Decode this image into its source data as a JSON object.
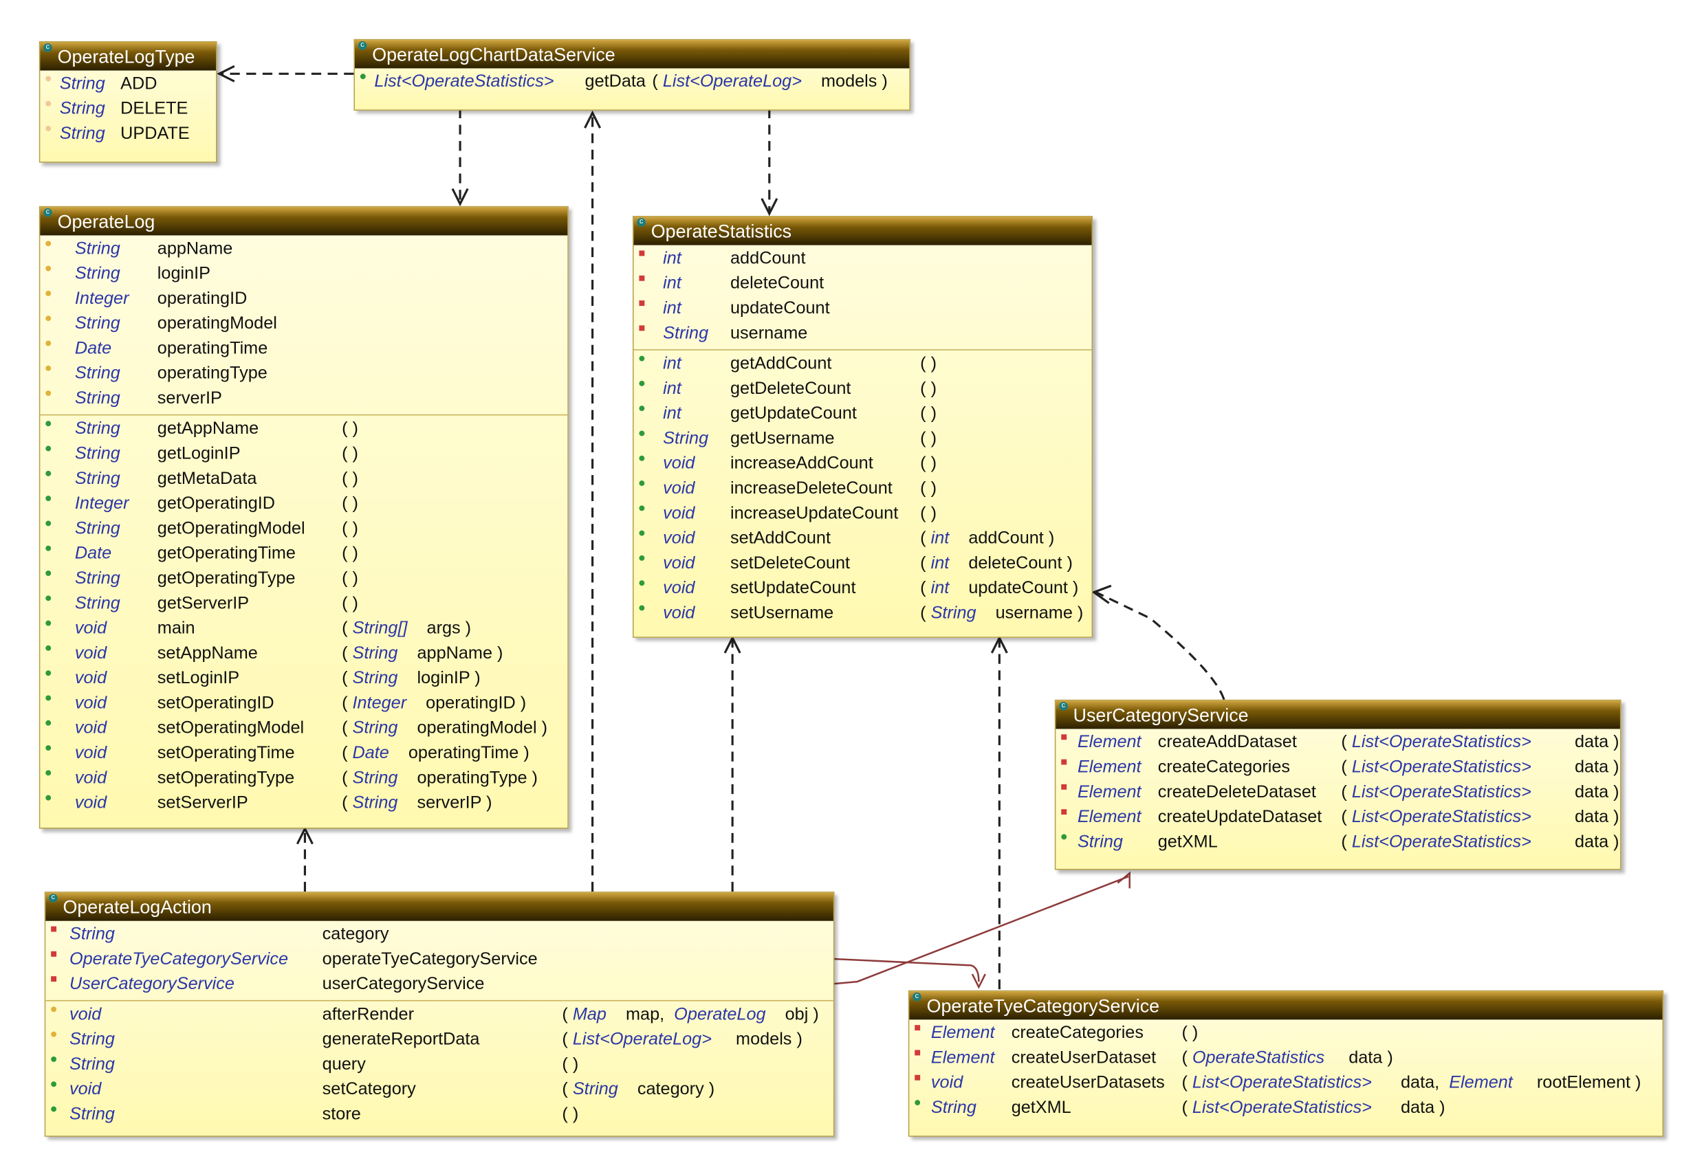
{
  "diagram": {
    "classes": [
      {
        "id": "operate-log-type",
        "title": "OperateLogType",
        "sections": [
          [
            {
              "vis": "pkg",
              "type": "String",
              "name": "ADD",
              "params": ""
            },
            {
              "vis": "pkg",
              "type": "String",
              "name": "DELETE",
              "params": ""
            },
            {
              "vis": "pkg",
              "type": "String",
              "name": "UPDATE",
              "params": ""
            }
          ]
        ]
      },
      {
        "id": "operate-log-chart-data-service",
        "title": "OperateLogChartDataService",
        "sections": [
          [
            {
              "vis": "pub",
              "type": "List<OperateStatistics>",
              "name": "getData",
              "params": "( <i>List&lt;OperateLog&gt;</i>&nbsp;&nbsp;&nbsp; models )"
            }
          ]
        ]
      },
      {
        "id": "operate-log",
        "title": "OperateLog",
        "sections": [
          [
            {
              "vis": "prot",
              "type": "String",
              "name": "appName",
              "params": ""
            },
            {
              "vis": "prot",
              "type": "String",
              "name": "loginIP",
              "params": ""
            },
            {
              "vis": "prot",
              "type": "Integer",
              "name": "operatingID",
              "params": ""
            },
            {
              "vis": "prot",
              "type": "String",
              "name": "operatingModel",
              "params": ""
            },
            {
              "vis": "prot",
              "type": "Date",
              "name": "operatingTime",
              "params": ""
            },
            {
              "vis": "prot",
              "type": "String",
              "name": "operatingType",
              "params": ""
            },
            {
              "vis": "prot",
              "type": "String",
              "name": "serverIP",
              "params": ""
            }
          ],
          [
            {
              "vis": "pub",
              "type": "String",
              "name": "getAppName",
              "params": "( )"
            },
            {
              "vis": "pub",
              "type": "String",
              "name": "getLoginIP",
              "params": "( )"
            },
            {
              "vis": "pub",
              "type": "String",
              "name": "getMetaData",
              "params": "( )"
            },
            {
              "vis": "pub",
              "type": "Integer",
              "name": "getOperatingID",
              "params": "( )"
            },
            {
              "vis": "pub",
              "type": "String",
              "name": "getOperatingModel",
              "params": "( )"
            },
            {
              "vis": "pub",
              "type": "Date",
              "name": "getOperatingTime",
              "params": "( )"
            },
            {
              "vis": "pub",
              "type": "String",
              "name": "getOperatingType",
              "params": "( )"
            },
            {
              "vis": "pub",
              "type": "String",
              "name": "getServerIP",
              "params": "( )"
            },
            {
              "vis": "pub",
              "type": "void",
              "name": "main",
              "params": "( <i>String[]</i>&nbsp;&nbsp;&nbsp; args )"
            },
            {
              "vis": "pub",
              "type": "void",
              "name": "setAppName",
              "params": "( <i>String</i>&nbsp;&nbsp;&nbsp; appName )"
            },
            {
              "vis": "pub",
              "type": "void",
              "name": "setLoginIP",
              "params": "( <i>String</i>&nbsp;&nbsp;&nbsp; loginIP )"
            },
            {
              "vis": "pub",
              "type": "void",
              "name": "setOperatingID",
              "params": "( <i>Integer</i>&nbsp;&nbsp;&nbsp; operatingID )"
            },
            {
              "vis": "pub",
              "type": "void",
              "name": "setOperatingModel",
              "params": "( <i>String</i>&nbsp;&nbsp;&nbsp; operatingModel )"
            },
            {
              "vis": "pub",
              "type": "void",
              "name": "setOperatingTime",
              "params": "( <i>Date</i>&nbsp;&nbsp;&nbsp; operatingTime )"
            },
            {
              "vis": "pub",
              "type": "void",
              "name": "setOperatingType",
              "params": "( <i>String</i>&nbsp;&nbsp;&nbsp; operatingType )"
            },
            {
              "vis": "pub",
              "type": "void",
              "name": "setServerIP",
              "params": "( <i>String</i>&nbsp;&nbsp;&nbsp; serverIP )"
            }
          ]
        ]
      },
      {
        "id": "operate-statistics",
        "title": "OperateStatistics",
        "sections": [
          [
            {
              "vis": "priv",
              "type": "int",
              "name": "addCount",
              "params": ""
            },
            {
              "vis": "priv",
              "type": "int",
              "name": "deleteCount",
              "params": ""
            },
            {
              "vis": "priv",
              "type": "int",
              "name": "updateCount",
              "params": ""
            },
            {
              "vis": "priv",
              "type": "String",
              "name": "username",
              "params": ""
            }
          ],
          [
            {
              "vis": "pub",
              "type": "int",
              "name": "getAddCount",
              "params": "( )"
            },
            {
              "vis": "pub",
              "type": "int",
              "name": "getDeleteCount",
              "params": "( )"
            },
            {
              "vis": "pub",
              "type": "int",
              "name": "getUpdateCount",
              "params": "( )"
            },
            {
              "vis": "pub",
              "type": "String",
              "name": "getUsername",
              "params": "( )"
            },
            {
              "vis": "pub",
              "type": "void",
              "name": "increaseAddCount",
              "params": "( )"
            },
            {
              "vis": "pub",
              "type": "void",
              "name": "increaseDeleteCount",
              "params": "( )"
            },
            {
              "vis": "pub",
              "type": "void",
              "name": "increaseUpdateCount",
              "params": "( )"
            },
            {
              "vis": "pub",
              "type": "void",
              "name": "setAddCount",
              "params": "( <i>int</i>&nbsp;&nbsp;&nbsp; addCount )"
            },
            {
              "vis": "pub",
              "type": "void",
              "name": "setDeleteCount",
              "params": "( <i>int</i>&nbsp;&nbsp;&nbsp; deleteCount )"
            },
            {
              "vis": "pub",
              "type": "void",
              "name": "setUpdateCount",
              "params": "( <i>int</i>&nbsp;&nbsp;&nbsp; updateCount )"
            },
            {
              "vis": "pub",
              "type": "void",
              "name": "setUsername",
              "params": "( <i>String</i>&nbsp;&nbsp;&nbsp; username )"
            }
          ]
        ]
      },
      {
        "id": "user-category-service",
        "title": "UserCategoryService",
        "sections": [
          [
            {
              "vis": "priv",
              "type": "Element",
              "name": "createAddDataset",
              "params": "( <i>List&lt;OperateStatistics&gt;</i>&nbsp;&nbsp;&nbsp;&nbsp;&nbsp;&nbsp;&nbsp;&nbsp; data )"
            },
            {
              "vis": "priv",
              "type": "Element",
              "name": "createCategories",
              "params": "( <i>List&lt;OperateStatistics&gt;</i>&nbsp;&nbsp;&nbsp;&nbsp;&nbsp;&nbsp;&nbsp;&nbsp; data )"
            },
            {
              "vis": "priv",
              "type": "Element",
              "name": "createDeleteDataset",
              "params": "( <i>List&lt;OperateStatistics&gt;</i>&nbsp;&nbsp;&nbsp;&nbsp;&nbsp;&nbsp;&nbsp;&nbsp; data )"
            },
            {
              "vis": "priv",
              "type": "Element",
              "name": "createUpdateDataset",
              "params": "( <i>List&lt;OperateStatistics&gt;</i>&nbsp;&nbsp;&nbsp;&nbsp;&nbsp;&nbsp;&nbsp;&nbsp; data )"
            },
            {
              "vis": "pub",
              "type": "String",
              "name": "getXML",
              "params": "( <i>List&lt;OperateStatistics&gt;</i>&nbsp;&nbsp;&nbsp;&nbsp;&nbsp;&nbsp;&nbsp;&nbsp; data )"
            }
          ]
        ]
      },
      {
        "id": "operate-log-action",
        "title": "OperateLogAction",
        "sections": [
          [
            {
              "vis": "priv",
              "type": "String",
              "name": "category",
              "params": ""
            },
            {
              "vis": "priv",
              "type": "OperateTyeCategoryService",
              "name": "operateTyeCategoryService",
              "params": ""
            },
            {
              "vis": "priv",
              "type": "UserCategoryService",
              "name": "userCategoryService",
              "params": ""
            }
          ],
          [
            {
              "vis": "prot",
              "type": "void",
              "name": "afterRender",
              "params": "( <i>Map</i>&nbsp;&nbsp;&nbsp; map, &nbsp;<i>OperateLog</i>&nbsp;&nbsp;&nbsp; obj )"
            },
            {
              "vis": "prot",
              "type": "String",
              "name": "generateReportData",
              "params": "( <i>List&lt;OperateLog&gt;</i>&nbsp;&nbsp;&nbsp;&nbsp; models )"
            },
            {
              "vis": "pub",
              "type": "String",
              "name": "query",
              "params": "( )"
            },
            {
              "vis": "pub",
              "type": "void",
              "name": "setCategory",
              "params": "( <i>String</i>&nbsp;&nbsp;&nbsp; category )"
            },
            {
              "vis": "pub",
              "type": "String",
              "name": "store",
              "params": "( )"
            }
          ]
        ]
      },
      {
        "id": "operate-tye-category-service",
        "title": "OperateTyeCategoryService",
        "sections": [
          [
            {
              "vis": "priv",
              "type": "Element",
              "name": "createCategories",
              "params": "( )"
            },
            {
              "vis": "priv",
              "type": "Element",
              "name": "createUserDataset",
              "params": "( <i>OperateStatistics</i>&nbsp;&nbsp;&nbsp;&nbsp; data )"
            },
            {
              "vis": "priv",
              "type": "void",
              "name": "createUserDatasets",
              "params": "( <i>List&lt;OperateStatistics&gt;</i>&nbsp;&nbsp;&nbsp;&nbsp;&nbsp; data, &nbsp;<i>Element</i>&nbsp;&nbsp;&nbsp;&nbsp; rootElement )"
            },
            {
              "vis": "pub",
              "type": "String",
              "name": "getXML",
              "params": "( <i>List&lt;OperateStatistics&gt;</i>&nbsp;&nbsp;&nbsp;&nbsp;&nbsp; data )"
            }
          ]
        ]
      }
    ]
  }
}
